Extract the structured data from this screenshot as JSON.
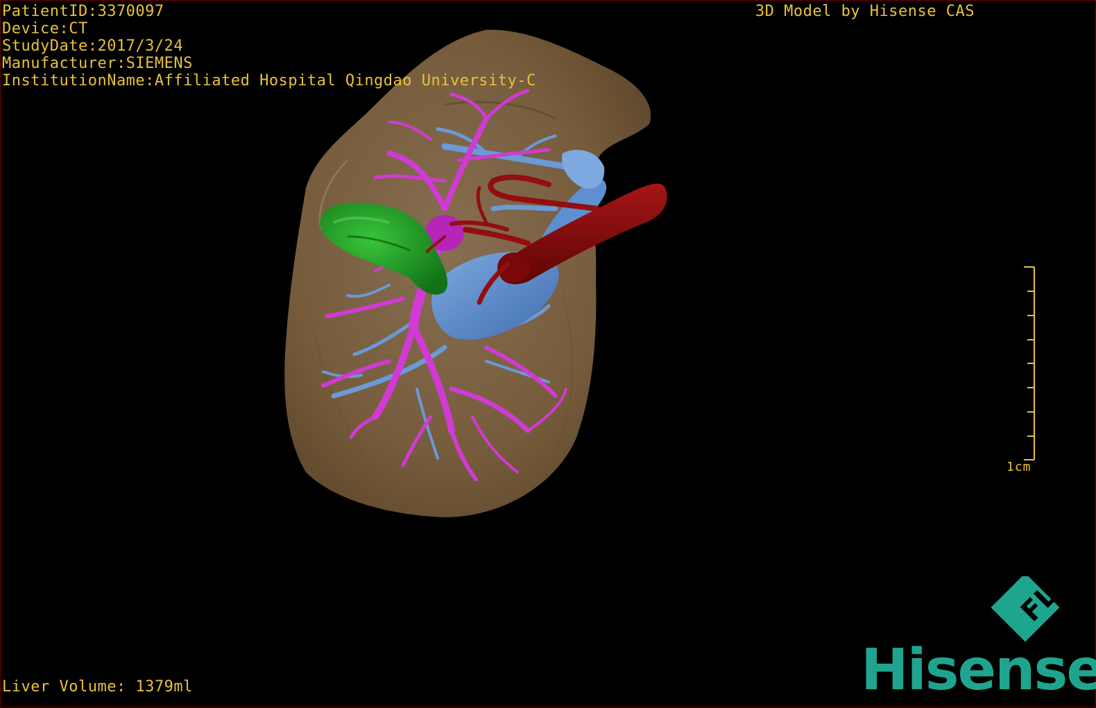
{
  "header": {
    "patient_id": "PatientID:3370097",
    "device": "Device:CT",
    "study_date": "StudyDate:2017/3/24",
    "manufacturer": "Manufacturer:SIEMENS",
    "institution": "InstitutionName:Affiliated Hospital Qingdao University-C"
  },
  "brand_top": "3D Model by Hisense CAS",
  "footer": {
    "liver_volume": "Liver Volume: 1379ml"
  },
  "scale_bar": {
    "label": "1cm",
    "color": "#e8c23a"
  },
  "logo": {
    "badge_text": "FL",
    "wordmark": "Hisense",
    "color": "#1fa58f"
  },
  "colors": {
    "text": "#e8c23a",
    "liver": "#8b6a45",
    "portal_vein": "#d23ad6",
    "hepatic_vein": "#5b8fd1",
    "artery": "#8e0b0b",
    "gallbladder": "#1f9e25"
  }
}
